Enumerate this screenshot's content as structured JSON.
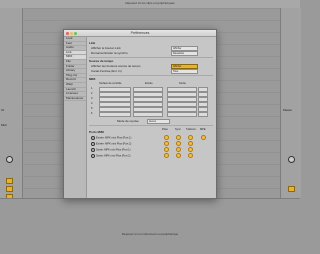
{
  "background": {
    "top_hint": "Déposez ici les clips et périphériques",
    "bottom_hint": "Déposez ici un instrument ou périphérique",
    "left_labels": [
      "IO",
      "Midi"
    ],
    "right_labels": [
      "Master"
    ]
  },
  "prefs_window": {
    "title": "Préférences",
    "tabs": [
      {
        "label": "Look"
      },
      {
        "label": "Feel"
      },
      {
        "label": "Audio"
      },
      {
        "label": "Link"
      },
      {
        "label": "MIDI"
      },
      {
        "label": "File"
      },
      {
        "label": "Folder"
      },
      {
        "label": "Library"
      },
      {
        "label": "Plug-Ins"
      },
      {
        "label": "Record"
      },
      {
        "label": "Warp"
      },
      {
        "label": "Launch"
      },
      {
        "label": "Licenses"
      },
      {
        "label": "Maintenance"
      }
    ],
    "link_section": {
      "heading": "Link",
      "rows": [
        {
          "label": "Afficher le bouton Link",
          "value": "Afficher"
        },
        {
          "label": "Démarrer/arrêter la synchro",
          "value": "Désactivé"
        }
      ]
    },
    "tempo_section": {
      "heading": "Source de tempo",
      "rows": [
        {
          "label": "Afficher les boutons source de tempo",
          "value": "Afficher"
        },
        {
          "label": "Canal d'entrée (Ext. In)",
          "value": "Tous"
        }
      ]
    },
    "midi_section": {
      "heading": "MIDI",
      "columns": [
        "Surface de contrôle",
        "Entrée",
        "Sortie"
      ],
      "rows": [
        "1",
        "2",
        "3",
        "4",
        "5",
        "6"
      ],
      "takeover_label": "Mode de reprise",
      "takeover_value": "Aucun"
    },
    "ports_section": {
      "heading": "Ports MIDI",
      "columns": [
        "Piste",
        "Sync",
        "Télécom.",
        "MPE"
      ],
      "devices": [
        "Entrée: MPK mini Plus (Port 1)",
        "Entrée: MPK mini Plus (Port 2)",
        "Sortie: MPK mini Plus (Port 1)",
        "Sortie: MPK mini Plus (Port 2)"
      ]
    }
  },
  "colors": {
    "accent": "#e9b12e",
    "window_bg": "#c6c6c6",
    "app_bg": "#9a9a9a"
  }
}
